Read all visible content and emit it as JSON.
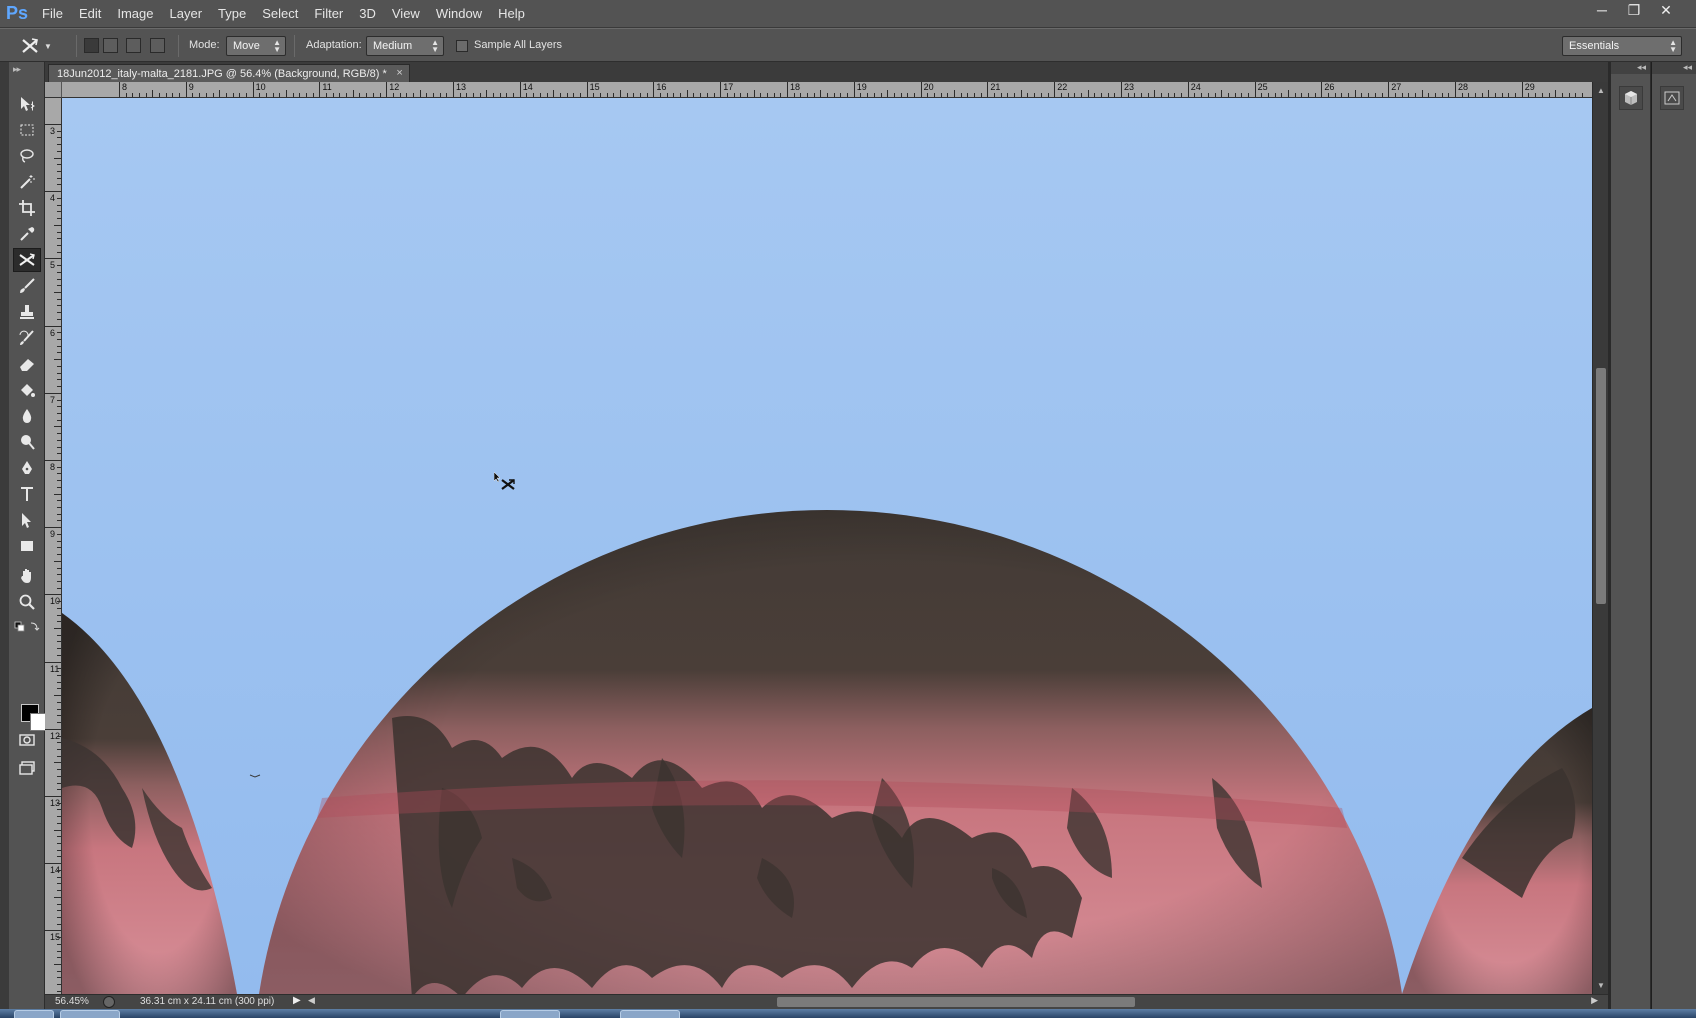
{
  "app": {
    "logo": "Ps",
    "menu": [
      "File",
      "Edit",
      "Image",
      "Layer",
      "Type",
      "Select",
      "Filter",
      "3D",
      "View",
      "Window",
      "Help"
    ],
    "window_controls": [
      "minimize-icon",
      "restore-icon",
      "close-icon"
    ]
  },
  "options_bar": {
    "tool_icon": "content-aware-move-icon",
    "mode_label": "Mode:",
    "mode_value": "Move",
    "adaptation_label": "Adaptation:",
    "adaptation_value": "Medium",
    "sample_all_layers_label": "Sample All Layers",
    "sample_all_layers_checked": false,
    "workspace_value": "Essentials"
  },
  "document": {
    "tab_title": "18Jun2012_italy-malta_2181.JPG @ 56.4% (Background, RGB/8) *",
    "tab_close": "×"
  },
  "rulers": {
    "horizontal_labels": [
      "8",
      "9",
      "10",
      "11",
      "12",
      "13",
      "14",
      "15",
      "16",
      "17",
      "18",
      "19",
      "20",
      "21",
      "22",
      "23",
      "24",
      "25",
      "26",
      "27",
      "28",
      "29"
    ],
    "vertical_labels": [
      "3",
      "4",
      "5",
      "6",
      "7",
      "8",
      "9",
      "10",
      "11",
      "12",
      "13",
      "14",
      "15"
    ]
  },
  "toolbar": {
    "tools": [
      "move-tool-icon",
      "rectangular-marquee-icon",
      "lasso-icon",
      "magic-wand-icon",
      "crop-icon",
      "eyedropper-icon",
      "content-aware-move-icon",
      "brush-icon",
      "clone-stamp-icon",
      "history-brush-icon",
      "eraser-icon",
      "paint-bucket-icon",
      "blur-icon",
      "dodge-icon",
      "pen-icon",
      "type-icon",
      "path-selection-icon",
      "rectangle-shape-icon",
      "hand-icon",
      "zoom-icon"
    ],
    "active_tool": "content-aware-move-icon",
    "foreground_color": "#000000",
    "background_color": "#ffffff"
  },
  "status": {
    "zoom": "56.45%",
    "doc_info": "36.31 cm x 24.11 cm (300 ppi)"
  },
  "colors": {
    "sky": "#9fc3ef",
    "dome_dark": "#3d3733",
    "dome_pink": "#c97f86",
    "panel_bg": "#535353"
  }
}
